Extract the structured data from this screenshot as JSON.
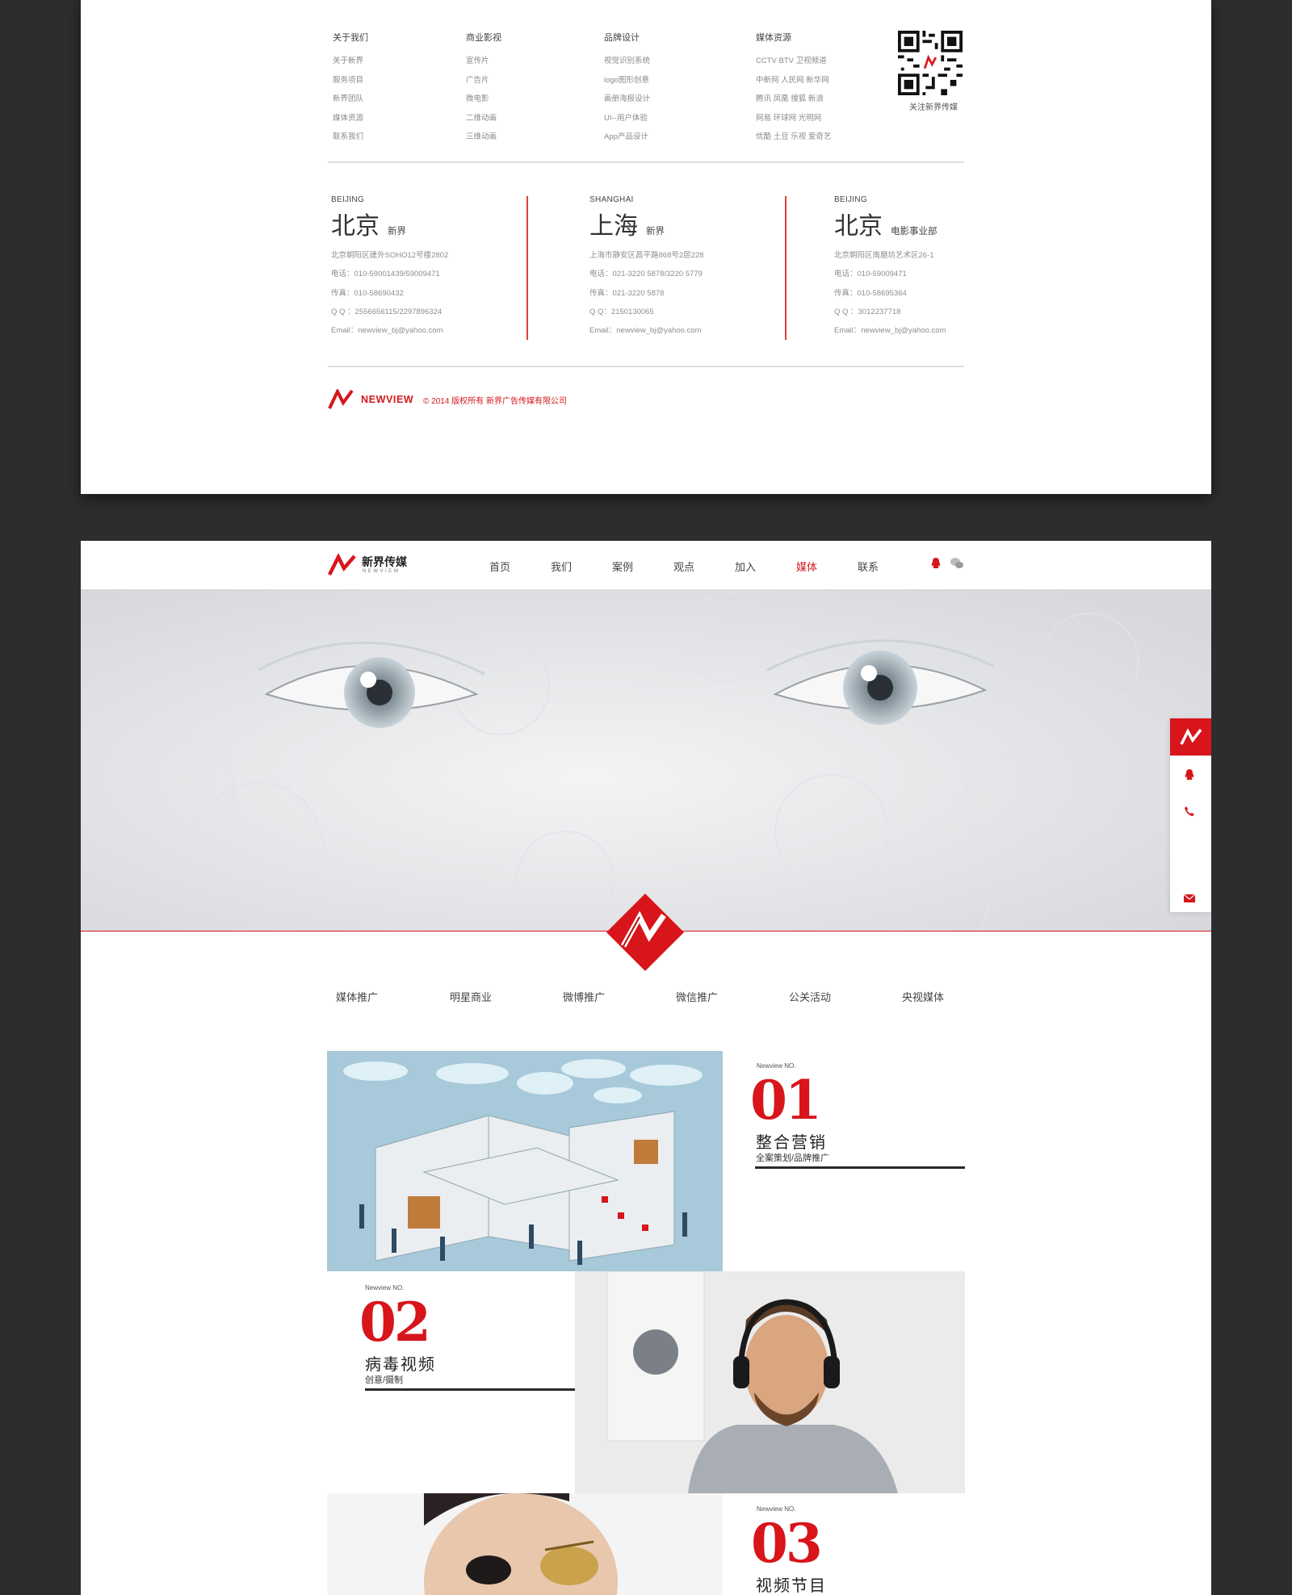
{
  "footer": {
    "columns": [
      {
        "title": "关于我们",
        "links": [
          "关于新界",
          "服务项目",
          "新界团队",
          "媒体资源",
          "联系我们"
        ]
      },
      {
        "title": "商业影视",
        "links": [
          "宣传片",
          "广告片",
          "微电影",
          "二维动画",
          "三维动画"
        ]
      },
      {
        "title": "品牌设计",
        "links": [
          "视觉识别系统",
          "logo图形创意",
          "画册海报设计",
          "UI--用户体验",
          "App产品设计"
        ]
      },
      {
        "title": "媒体资源",
        "links": [
          "CCTV BTV 卫视频道",
          "中新网 人民网 新华网",
          "腾讯 凤凰 搜狐 新浪",
          "网易 环球网 光明网",
          "优酷 土豆 乐视 爱奇艺"
        ]
      }
    ],
    "qr_caption": "关注新界传媒",
    "offices": [
      {
        "en": "BEIJING",
        "city": "北京",
        "sub": "新界",
        "lines": [
          "北京朝阳区建外SOHO12号楼2802",
          "电话：010-59001439/59009471",
          "传真：010-58690432",
          "Q Q ：2556656115/2297896324",
          "Email：newview_bj@yahoo.com"
        ]
      },
      {
        "en": "SHANGHAI",
        "city": "上海",
        "sub": "新界",
        "lines": [
          "上海市静安区昌平路868号2层228",
          "电话：021-3220 5878/3220 5779",
          "传真：021-3220 5878",
          "Q Q：2150130065",
          "Email：newview_bj@yahoo.com"
        ]
      },
      {
        "en": "BEIJING",
        "city": "北京",
        "sub": "电影事业部",
        "lines": [
          "北京朝阳区南磨坊艺术区26-1",
          "电话：010-59009471",
          "传真：010-58695364",
          "Q Q ：3012237718",
          "Email：newview_bj@yahoo.com"
        ]
      }
    ],
    "brand": "NEWVIEW",
    "copyright": "© 2014 版权所有 新界广告传媒有限公司"
  },
  "header": {
    "brand_cn": "新界传媒",
    "brand_en": "NEWVIEW",
    "nav": [
      "首页",
      "我们",
      "案例",
      "观点",
      "加入",
      "媒体",
      "联系"
    ],
    "active": "媒体"
  },
  "categories": [
    "媒体推广",
    "明星商业",
    "微博推广",
    "微信推广",
    "公关活动",
    "央视媒体"
  ],
  "features": [
    {
      "label": "Newview NO.",
      "num": "01",
      "title": "整合营销",
      "sub": "全案策划/品牌推广"
    },
    {
      "label": "Newview NO.",
      "num": "02",
      "title": "病毒视频",
      "sub": "创意/摄制"
    },
    {
      "label": "Newview NO.",
      "num": "03",
      "title": "视频节目",
      "sub": ""
    }
  ],
  "colors": {
    "accent": "#d7151b",
    "frame": "#2d2d2f"
  }
}
